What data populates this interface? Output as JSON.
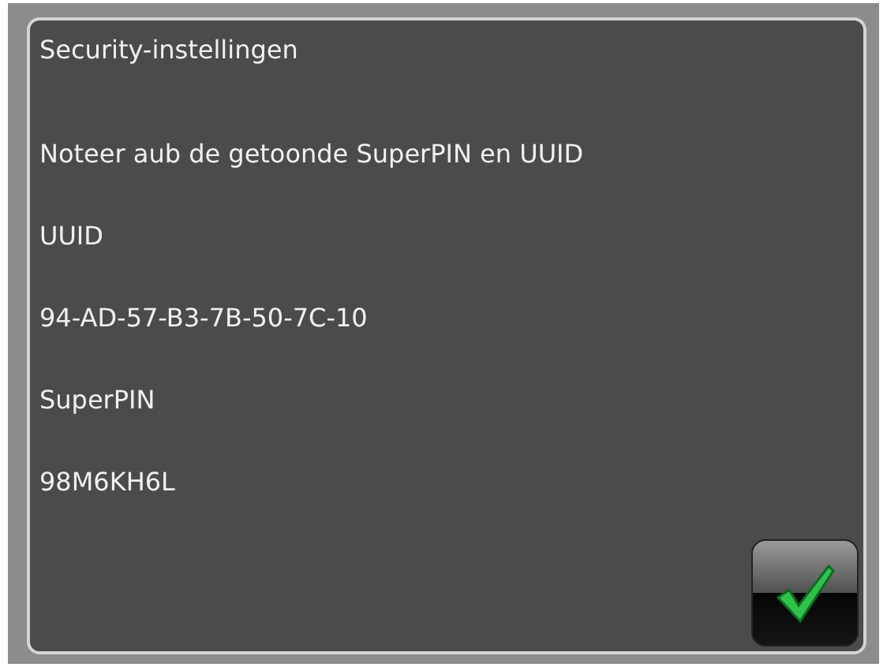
{
  "title": "Security-instellingen",
  "lines": [
    "Noteer aub de getoonde SuperPIN en UUID",
    "UUID",
    "94-AD-57-B3-7B-50-7C-10",
    "SuperPIN",
    "98M6KH6L"
  ],
  "confirm_button": {
    "kind": "check"
  }
}
